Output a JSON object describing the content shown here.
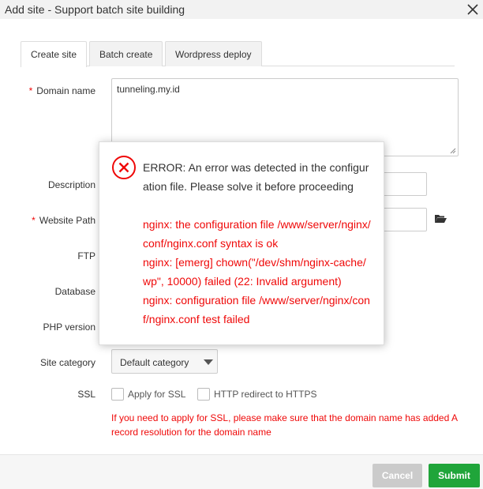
{
  "dialog": {
    "title": "Add site - Support batch site building"
  },
  "tabs": [
    {
      "label": "Create site"
    },
    {
      "label": "Batch create"
    },
    {
      "label": "Wordpress deploy"
    }
  ],
  "form": {
    "domain_label": "Domain name",
    "domain_value": "tunneling.my.id",
    "description_label": "Description",
    "path_label": "Website Path",
    "ftp_label": "FTP",
    "database_label": "Database",
    "php_label": "PHP version",
    "category_label": "Site category",
    "category_value": "Default category",
    "ssl_label": "SSL",
    "apply_ssl_label": "Apply for SSL",
    "http_redirect_label": "HTTP redirect to HTTPS",
    "ssl_note": "If you need to apply for SSL, please make sure that the domain name has added A record resolution for the domain name"
  },
  "footer": {
    "cancel_label": "Cancel",
    "submit_label": "Submit"
  },
  "error": {
    "heading": "ERROR: An error was detected in the configuration file. Please solve it before proceeding",
    "lines": [
      "nginx: the configuration file /www/server/nginx/conf/nginx.conf syntax is ok",
      "nginx: [emerg] chown(\"/dev/shm/nginx-cache/wp\", 10000) failed (22: Invalid argument)",
      "nginx: configuration file /www/server/nginx/conf/nginx.conf test failed"
    ]
  },
  "colors": {
    "error_red": "#ef0808",
    "submit_green": "#20a53a",
    "cancel_gray": "#cbcbcb"
  }
}
